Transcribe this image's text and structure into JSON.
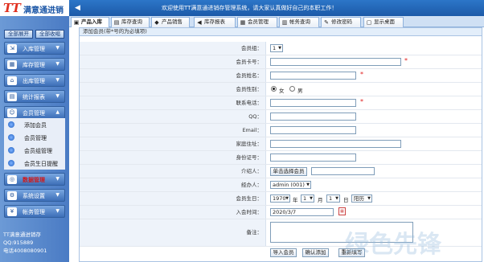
{
  "app": {
    "logo_tt": "TT",
    "logo_text": "满意通进销存",
    "welcome": "欢迎使用TT满意通进销存管理系统，请大家认真做好自己的本职工作！"
  },
  "tabs": [
    {
      "label": "产品入库",
      "icon": "box-icon",
      "glyph": "▣",
      "active": true
    },
    {
      "label": "库存查询",
      "icon": "document-icon",
      "glyph": "▤"
    },
    {
      "label": "产品销售",
      "icon": "tag-icon",
      "glyph": "◆"
    },
    {
      "label": "库存报表",
      "icon": "speaker-icon",
      "glyph": "◀"
    },
    {
      "label": "会员管理",
      "icon": "member-icon",
      "glyph": "▦"
    },
    {
      "label": "帐务查询",
      "icon": "book-icon",
      "glyph": "▥"
    },
    {
      "label": "修改密码",
      "icon": "key-icon",
      "glyph": "✎"
    },
    {
      "label": "显示桌面",
      "icon": "desktop-icon",
      "glyph": "▢"
    }
  ],
  "sidebar": {
    "expand_all": "全部展开",
    "collapse_all": "全部收缩",
    "menus": [
      {
        "label": "入库管理",
        "icon": "inbound-icon",
        "glyph": "⇲"
      },
      {
        "label": "库存管理",
        "icon": "warehouse-icon",
        "glyph": "▦"
      },
      {
        "label": "出库管理",
        "icon": "outbound-icon",
        "glyph": "⌂"
      },
      {
        "label": "统计报表",
        "icon": "report-icon",
        "glyph": "▤"
      },
      {
        "label": "会员管理",
        "icon": "members-icon",
        "glyph": "☺"
      }
    ],
    "submenu": [
      "添加会员",
      "会员管理",
      "会员组管理",
      "会员生日提醒"
    ],
    "menus2": [
      {
        "label": "数据管理",
        "icon": "database-icon",
        "glyph": "◎",
        "red": true
      },
      {
        "label": "系统设置",
        "icon": "settings-icon",
        "glyph": "⚙"
      },
      {
        "label": "帐务管理",
        "icon": "accounts-icon",
        "glyph": "¥"
      }
    ],
    "footer_line1": "TT满意通进销存 QQ:915889",
    "footer_line2": "电话4008080901"
  },
  "form": {
    "header": "添加会员(带*号的为必填项)",
    "group_label": "会员组：",
    "group_value": "1",
    "card_label": "会员卡号：",
    "name_label": "会员姓名：",
    "gender_label": "会员性别：",
    "gender_female": "女",
    "gender_male": "男",
    "phone_label": "联系电话：",
    "qq_label": "QQ：",
    "email_label": "Email：",
    "address_label": "家庭住址：",
    "idcard_label": "身份证号：",
    "referrer_label": "介绍人：",
    "referrer_button": "单击选择会员",
    "handler_label": "经办人：",
    "handler_value": "admin (001)",
    "birthday_label": "会员生日：",
    "birth_year": "1970",
    "year_unit": "年",
    "birth_month": "1",
    "month_unit": "月",
    "birth_day": "1",
    "day_unit": "日",
    "calendar_type": "阳历",
    "join_label": "入会时间：",
    "join_value": "2020/3/7",
    "notes_label": "备注：",
    "required_mark": "*",
    "import_button": "导入会员",
    "confirm_button": "确认添加",
    "reset_button": "重新填写"
  },
  "watermark": "绿色先锋"
}
